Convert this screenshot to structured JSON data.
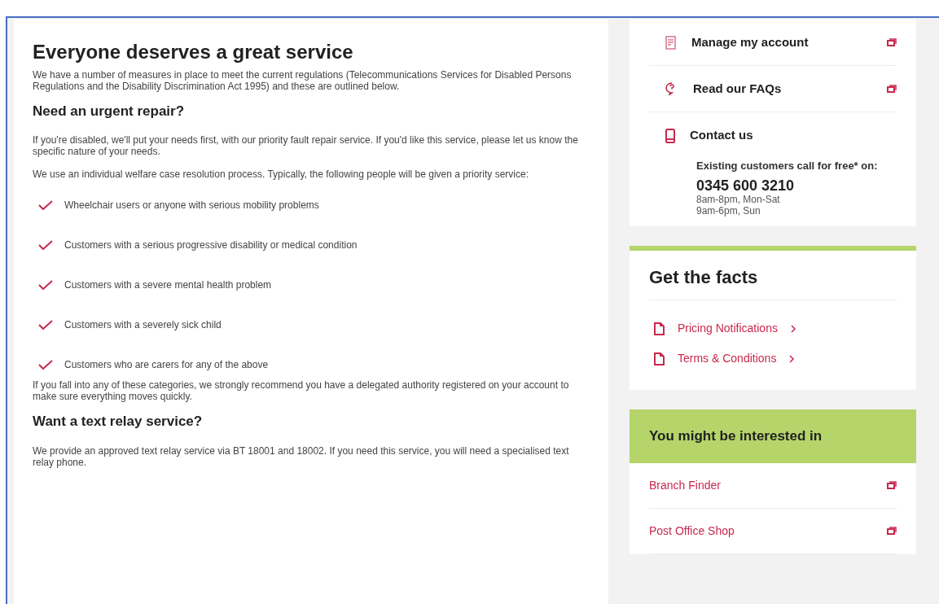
{
  "main": {
    "blocks": [
      {
        "kind": "title",
        "text": "Everyone deserves a great service"
      },
      {
        "kind": "paragraph",
        "text": "We have a number of measures in place to meet the current regulations (Telecommunications Services for Disabled Persons Regulations and the Disability Discrimination Act 1995) and these are outlined below."
      },
      {
        "kind": "heading",
        "text": "Need an urgent repair?"
      },
      {
        "kind": "paragraph",
        "text": "If you're disabled, we'll put your needs first, with our priority fault repair service. If you'd like this service, please let us know the specific nature of your needs."
      },
      {
        "kind": "paragraph",
        "text": "We use an individual welfare case resolution process. Typically, the following people will be given a priority service:"
      },
      {
        "kind": "checklist",
        "items": [
          "Wheelchair users or anyone with serious mobility problems",
          "Customers with a serious progressive disability or medical condition",
          "Customers with a severe mental health problem",
          "Customers with a severely sick child",
          "Customers who are carers for any of the above"
        ]
      },
      {
        "kind": "paragraph",
        "text": "If you fall into any of these categories, we strongly recommend you have a delegated authority registered on your account to make sure everything moves quickly."
      },
      {
        "kind": "heading",
        "text": "Want a text relay service?"
      },
      {
        "kind": "paragraph",
        "text": "We provide an approved text relay service via BT 18001 and 18002. If you need this service, you will need a specialised text relay phone."
      }
    ]
  },
  "sidebar": {
    "quick_links": [
      {
        "label": "Manage my account",
        "external": true
      },
      {
        "label": "Read our FAQs",
        "external": true
      },
      {
        "label": "Contact us",
        "external": false
      }
    ],
    "contact": {
      "note": "Existing customers call for free* on:",
      "phone": "0345 600 3210",
      "hours": [
        "8am-8pm, Mon-Sat",
        "9am-6pm, Sun"
      ]
    },
    "facts": {
      "title": "Get the facts",
      "links": [
        "Pricing Notifications",
        "Terms & Conditions"
      ]
    },
    "interested": {
      "title": "You might be interested in",
      "links": [
        {
          "label": "Branch Finder",
          "external": true
        },
        {
          "label": "Post Office Shop",
          "external": true
        }
      ]
    }
  }
}
